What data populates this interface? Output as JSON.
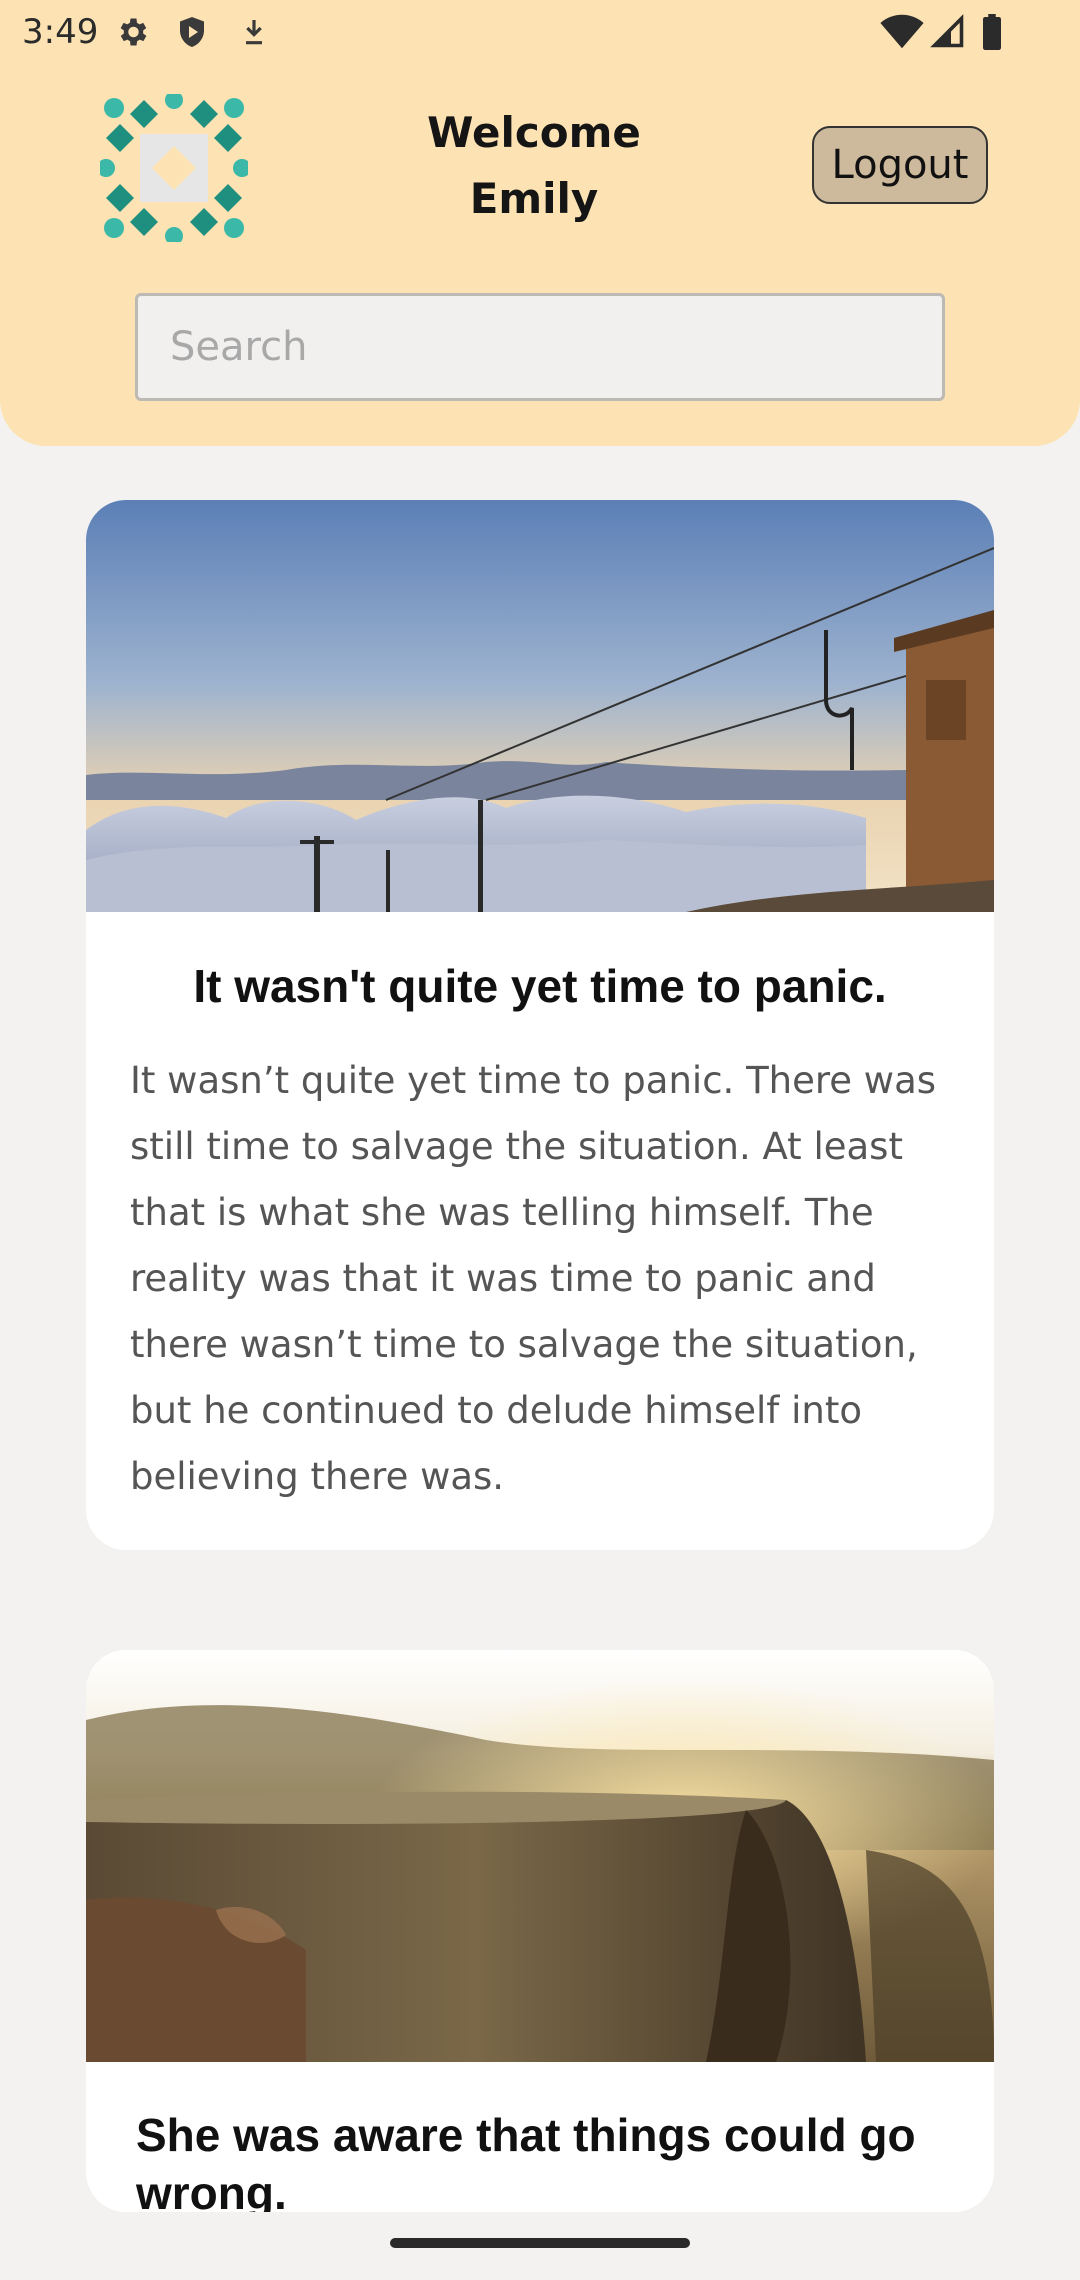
{
  "status_bar": {
    "time": "3:49",
    "left_icons": [
      "settings-icon",
      "shield-icon",
      "download-icon"
    ],
    "right_icons": [
      "wifi-icon",
      "signal-icon",
      "battery-icon"
    ]
  },
  "header": {
    "logo": "logo-icon",
    "welcome_line1": "Welcome",
    "welcome_line2": "Emily",
    "logout_label": "Logout",
    "search_placeholder": "Search",
    "background_color": "#fde3b3"
  },
  "posts": [
    {
      "image": "ski-lift-above-clouds",
      "title": "It wasn't quite yet time to panic.",
      "body": "It wasn’t quite yet time to panic. There was still time to salvage the situation. At least that is what she was telling himself. The reality was that it was time to panic and there wasn’t time to salvage the situation, but he continued to delude himself into believing there was."
    },
    {
      "image": "tree-stump-at-sunset",
      "title": "She was aware that things could go wrong.",
      "body": ""
    }
  ]
}
